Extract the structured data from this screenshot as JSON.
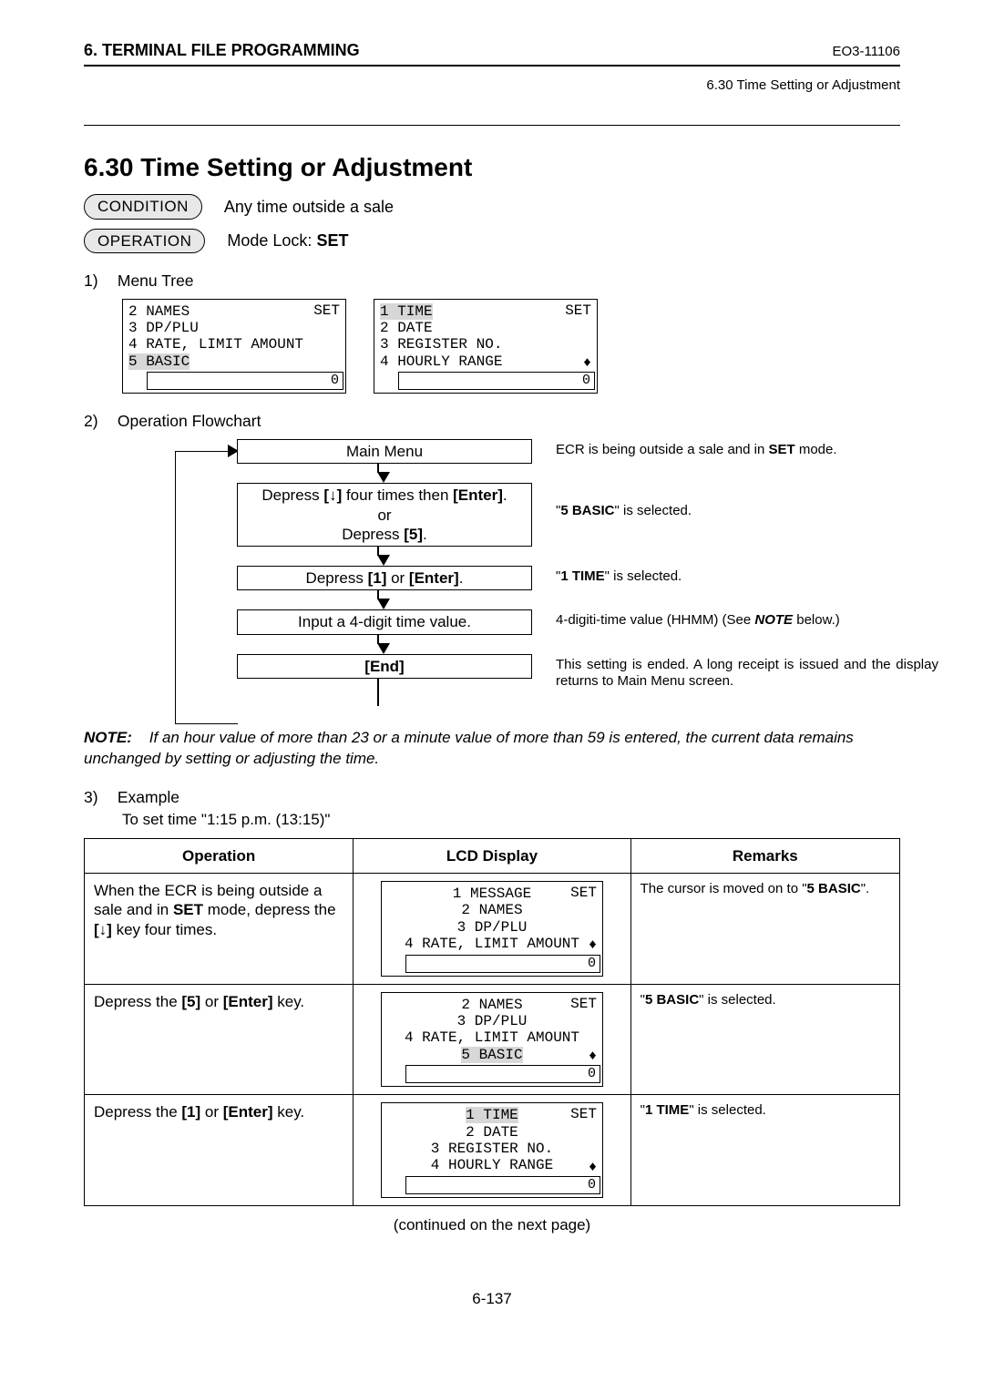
{
  "header": {
    "left": "6. TERMINAL FILE PROGRAMMING",
    "right": "EO3-11106",
    "subtitle": "6.30 Time Setting or Adjustment"
  },
  "title": "6.30    Time Setting or Adjustment",
  "condition": {
    "label": "CONDITION",
    "text": "Any time outside a sale"
  },
  "operation": {
    "label": "OPERATION",
    "text_pre": "Mode Lock: ",
    "text_bold": "SET"
  },
  "sec1": {
    "num": "1)",
    "title": "Menu Tree"
  },
  "lcd_left": {
    "tag": "SET",
    "rows": [
      "2 NAMES",
      "3 DP/PLU",
      "4 RATE, LIMIT AMOUNT",
      "5 BASIC"
    ],
    "highlight_index": 3,
    "input": "0"
  },
  "lcd_right": {
    "tag": "SET",
    "rows": [
      "1 TIME",
      "2 DATE",
      "3 REGISTER NO.",
      "4 HOURLY RANGE"
    ],
    "highlight_index": 0,
    "input": "0",
    "arrows": "♦"
  },
  "sec2": {
    "num": "2)",
    "title": "Operation Flowchart"
  },
  "flow": {
    "steps": [
      {
        "box": "Main Menu",
        "caption_pre": "ECR is being outside a sale and in ",
        "caption_b": "SET",
        "caption_post": " mode."
      },
      {
        "box_lines": [
          "Depress [↓] four times then [Enter].",
          "or",
          "Depress [5]."
        ],
        "caption_pre": "\"",
        "caption_b": "5 BASIC",
        "caption_post": "\" is selected."
      },
      {
        "box_parts": [
          "Depress ",
          "[1]",
          " or ",
          "[Enter]",
          "."
        ],
        "caption_pre": "\"",
        "caption_b": "1 TIME",
        "caption_post": "\" is selected."
      },
      {
        "box": "Input a 4-digit time value.",
        "caption_plain_pre": "4-digiti-time value (HHMM) (See ",
        "caption_bi": "NOTE",
        "caption_plain_post": " below.)"
      },
      {
        "box_b": "[End]",
        "caption_plain": "This setting is ended.  A long receipt is issued and the display returns to Main Menu screen."
      }
    ]
  },
  "note": {
    "label": "NOTE:",
    "text": "If an hour value of more than 23 or a minute value of more than 59 is entered, the current data remains unchanged by setting or adjusting the time."
  },
  "sec3": {
    "num": "3)",
    "title": "Example",
    "sub": "To set time \"1:15 p.m. (13:15)\""
  },
  "table": {
    "headers": [
      "Operation",
      "LCD Display",
      "Remarks"
    ],
    "rows": [
      {
        "op_parts": [
          "When the ECR is being outside a sale and in ",
          "SET",
          " mode, depress the ",
          "[↓]",
          " key four times."
        ],
        "lcd": {
          "tag": "SET",
          "rows": [
            "1 MESSAGE",
            "2 NAMES",
            "3 DP/PLU",
            "4 RATE, LIMIT AMOUNT"
          ],
          "highlight_index": -1,
          "input": "0",
          "arrows": "♦"
        },
        "rem_pre": "The cursor is moved on to \"",
        "rem_b": "5 BASIC",
        "rem_post": "\"."
      },
      {
        "op_parts": [
          "Depress the ",
          "[5]",
          " or ",
          "[Enter]",
          " key."
        ],
        "lcd": {
          "tag": "SET",
          "rows": [
            "2 NAMES",
            "3 DP/PLU",
            "4 RATE, LIMIT AMOUNT",
            "5 BASIC"
          ],
          "highlight_index": 3,
          "input": "0",
          "arrows": "♦"
        },
        "rem_pre": "\"",
        "rem_b": "5 BASIC",
        "rem_post": "\" is selected."
      },
      {
        "op_parts": [
          "Depress the ",
          "[1]",
          " or ",
          "[Enter]",
          " key."
        ],
        "lcd": {
          "tag": "SET",
          "rows": [
            "1 TIME",
            "2 DATE",
            "3 REGISTER NO.",
            "4 HOURLY RANGE"
          ],
          "highlight_index": 0,
          "input": "0",
          "arrows": "♦"
        },
        "rem_pre": "\"",
        "rem_b": "1 TIME",
        "rem_post": "\" is selected."
      }
    ]
  },
  "continued": "(continued on the next page)",
  "page_number": "6-137",
  "glyph_down": "↓"
}
